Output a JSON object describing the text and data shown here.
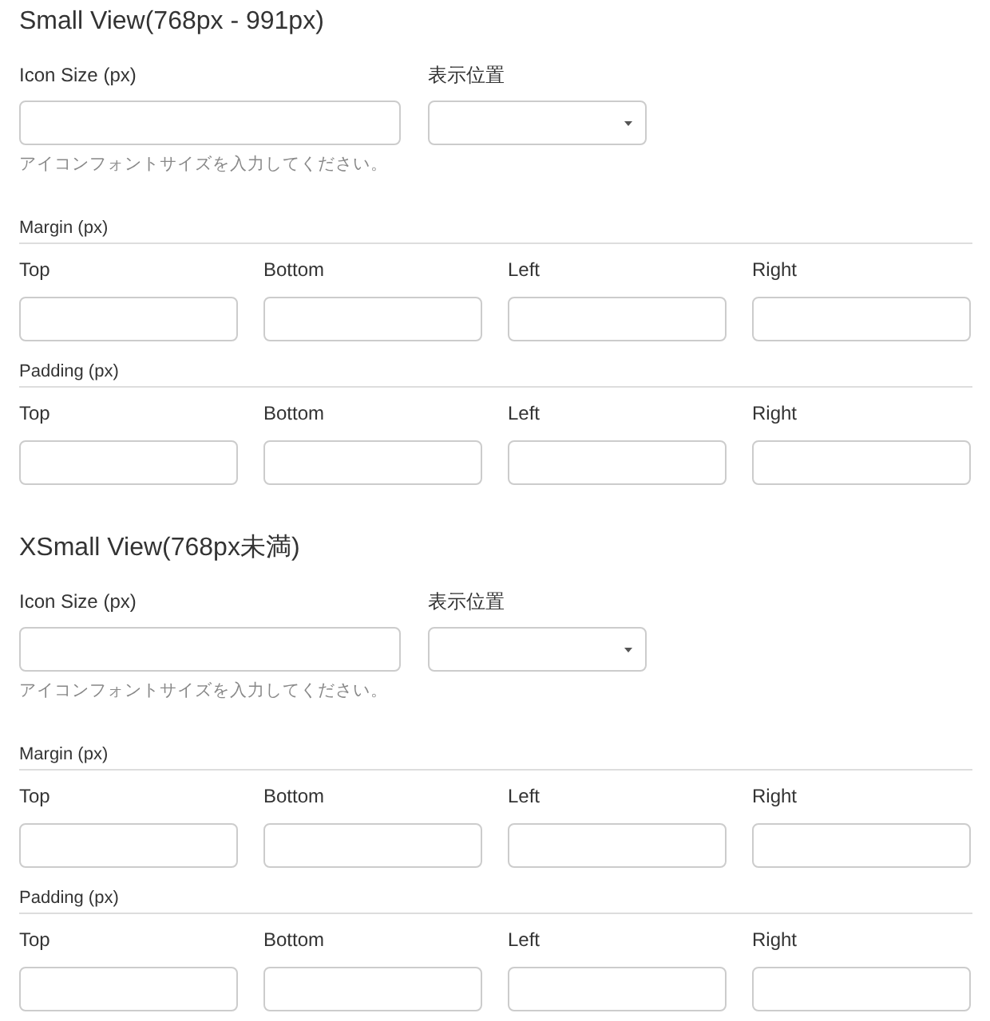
{
  "sections": [
    {
      "title": "Small View(768px - 991px)",
      "icon_size": {
        "label": "Icon Size (px)"
      },
      "position": {
        "label": "表示位置"
      },
      "help": "アイコンフォントサイズを入力してください。",
      "groups": [
        {
          "label": "Margin (px)",
          "fields": [
            "Top",
            "Bottom",
            "Left",
            "Right"
          ]
        },
        {
          "label": "Padding (px)",
          "fields": [
            "Top",
            "Bottom",
            "Left",
            "Right"
          ]
        }
      ]
    },
    {
      "title": "XSmall View(768px未満)",
      "icon_size": {
        "label": "Icon Size (px)"
      },
      "position": {
        "label": "表示位置"
      },
      "help": "アイコンフォントサイズを入力してください。",
      "groups": [
        {
          "label": "Margin (px)",
          "fields": [
            "Top",
            "Bottom",
            "Left",
            "Right"
          ]
        },
        {
          "label": "Padding (px)",
          "fields": [
            "Top",
            "Bottom",
            "Left",
            "Right"
          ]
        }
      ]
    }
  ]
}
